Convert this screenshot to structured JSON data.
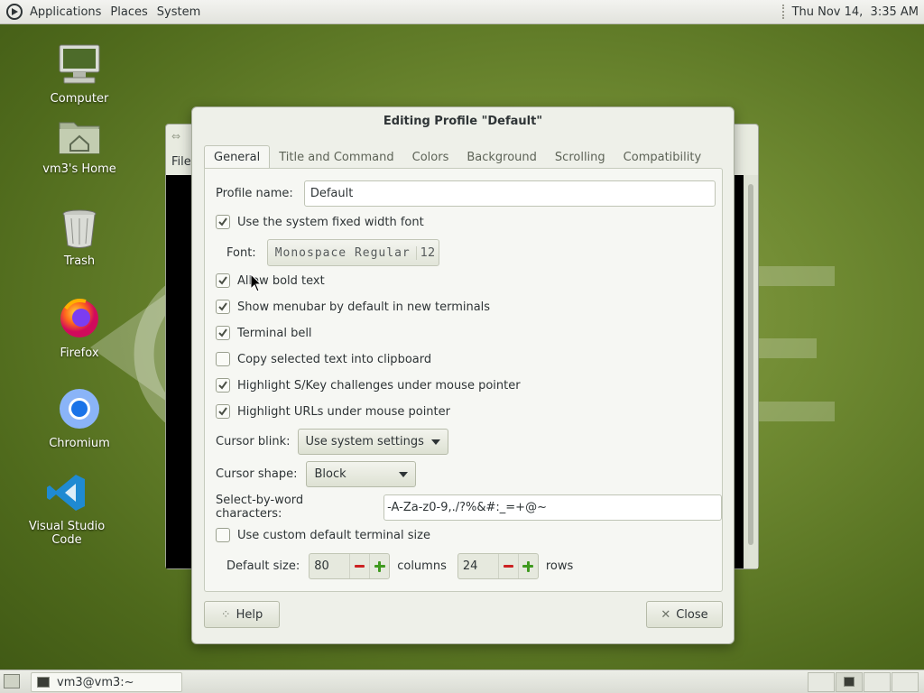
{
  "top_panel": {
    "menus": [
      "Applications",
      "Places",
      "System"
    ],
    "clock": "Thu Nov 14,  3:35 AM"
  },
  "desktop_icons": [
    {
      "label": "Computer",
      "icon": "computer-icon"
    },
    {
      "label": "vm3's Home",
      "icon": "home-folder-icon"
    },
    {
      "label": "Trash",
      "icon": "trash-icon"
    },
    {
      "label": "Firefox",
      "icon": "firefox-icon"
    },
    {
      "label": "Chromium",
      "icon": "chromium-icon"
    },
    {
      "label": "Visual Studio Code",
      "icon": "vscode-icon"
    }
  ],
  "terminal_window": {
    "menu_first": "File"
  },
  "dialog": {
    "title": "Editing Profile \"Default\"",
    "tabs": [
      "General",
      "Title and Command",
      "Colors",
      "Background",
      "Scrolling",
      "Compatibility"
    ],
    "active_tab": "General",
    "profile_name_label": "Profile name:",
    "profile_name_value": "Default",
    "use_system_font": {
      "label": "Use the system fixed width font",
      "checked": true
    },
    "font_label": "Font:",
    "font_name": "Monospace Regular",
    "font_size": "12",
    "allow_bold": {
      "label": "Allow bold text",
      "checked": true
    },
    "show_menubar": {
      "label": "Show menubar by default in new terminals",
      "checked": true
    },
    "terminal_bell": {
      "label": "Terminal bell",
      "checked": true
    },
    "copy_selected": {
      "label": "Copy selected text into clipboard",
      "checked": false
    },
    "highlight_skey": {
      "label": "Highlight S/Key challenges under mouse pointer",
      "checked": true
    },
    "highlight_urls": {
      "label": "Highlight URLs under mouse pointer",
      "checked": true
    },
    "cursor_blink_label": "Cursor blink:",
    "cursor_blink_value": "Use system settings",
    "cursor_shape_label": "Cursor shape:",
    "cursor_shape_value": "Block",
    "select_word_label": "Select-by-word characters:",
    "select_word_value": "-A-Za-z0-9,./?%&#:_=+@~",
    "custom_size": {
      "label": "Use custom default terminal size",
      "checked": false
    },
    "default_size_label": "Default size:",
    "columns_value": "80",
    "columns_label": "columns",
    "rows_value": "24",
    "rows_label": "rows",
    "help_button": "Help",
    "close_button": "Close"
  },
  "bottom_panel": {
    "task_label": "vm3@vm3:~"
  }
}
